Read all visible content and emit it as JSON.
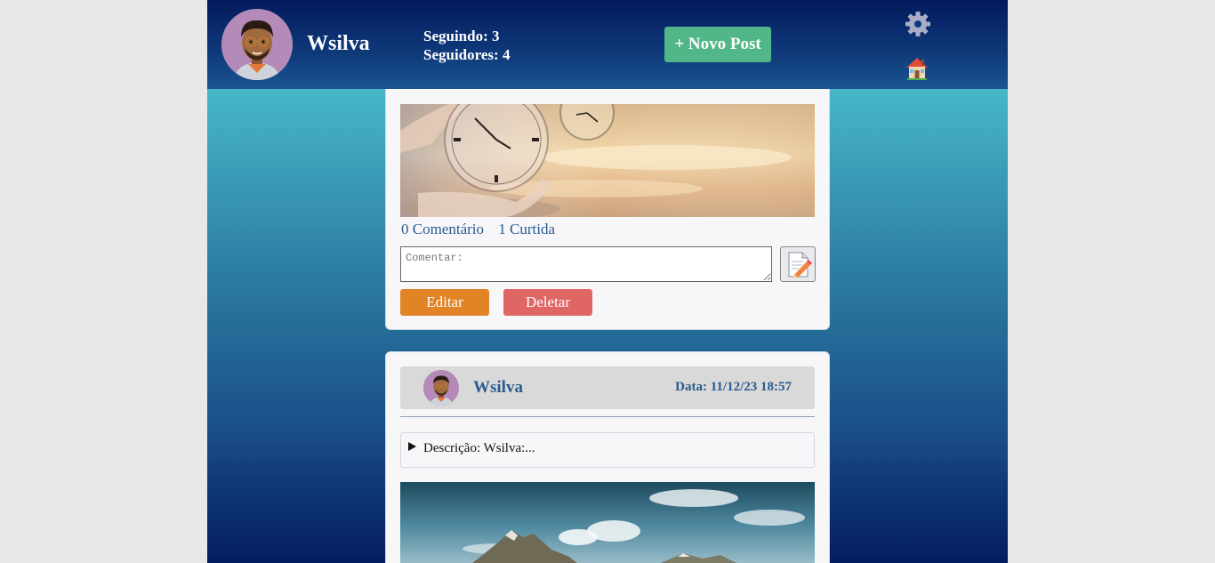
{
  "header": {
    "username": "Wsilva",
    "following": "Seguindo: 3",
    "followers": "Seguidores: 4",
    "new_post_label": "+ Novo Post",
    "settings_icon": "gear-icon",
    "home_icon": "home-icon"
  },
  "post1": {
    "comments": "0 Comentário",
    "likes": "1 Curtida",
    "comment_placeholder": "Comentar:",
    "edit_label": "Editar",
    "delete_label": "Deletar"
  },
  "post2": {
    "author": "Wsilva",
    "date": "Data: 11/12/23 18:57",
    "description": "Descrição: Wsilva:..."
  },
  "colors": {
    "header_bg": "#0f3a7a",
    "new_post_bg": "#52b788",
    "edit_bg": "#e08426",
    "delete_bg": "#e06666",
    "link": "#2b5b8e"
  }
}
